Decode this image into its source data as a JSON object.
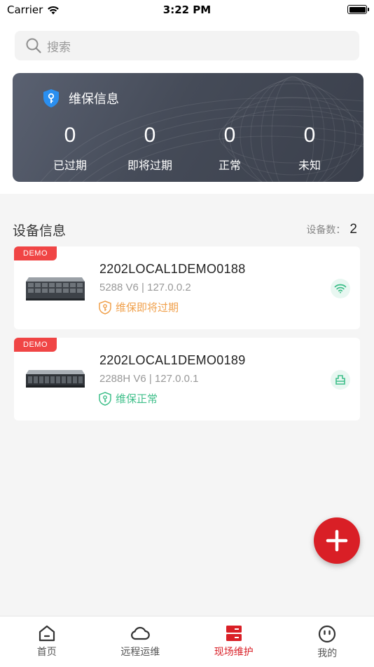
{
  "status_bar": {
    "carrier": "Carrier",
    "time": "3:22 PM"
  },
  "search": {
    "placeholder": "搜索",
    "icon": "search-icon"
  },
  "maintenance": {
    "title": "维保信息",
    "stats": [
      {
        "value": "0",
        "label": "已过期"
      },
      {
        "value": "0",
        "label": "即将过期"
      },
      {
        "value": "0",
        "label": "正常"
      },
      {
        "value": "0",
        "label": "未知"
      }
    ]
  },
  "devices_section": {
    "title": "设备信息",
    "count_label": "设备数：",
    "count": "2"
  },
  "devices": [
    {
      "badge": "DEMO",
      "name": "2202LOCAL1DEMO0188",
      "sub": "5288 V6 | 127.0.0.2",
      "status": "维保即将过期",
      "status_color": "#f0a04b",
      "action_icon": "wifi-icon"
    },
    {
      "badge": "DEMO",
      "name": "2202LOCAL1DEMO0189",
      "sub": "2288H V6 | 127.0.0.1",
      "status": "维保正常",
      "status_color": "#3fbf8a",
      "action_icon": "ethernet-icon"
    }
  ],
  "tabs": [
    {
      "label": "首页",
      "icon": "home-icon",
      "active": false
    },
    {
      "label": "远程运维",
      "icon": "cloud-icon",
      "active": false
    },
    {
      "label": "现场维护",
      "icon": "server-icon",
      "active": true
    },
    {
      "label": "我的",
      "icon": "profile-icon",
      "active": false
    }
  ],
  "colors": {
    "accent": "#d91f26",
    "badge": "#f04545",
    "ok": "#3fbf8a",
    "warn": "#f0a04b",
    "card": "#454b58"
  }
}
